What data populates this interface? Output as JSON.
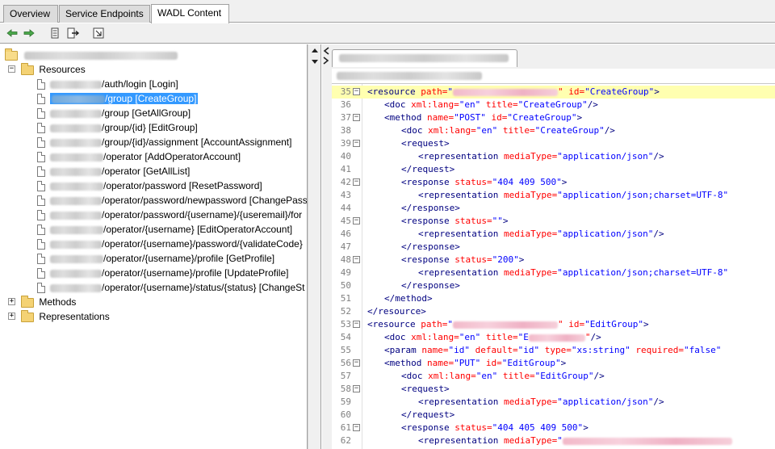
{
  "tabs": [
    {
      "label": "Overview",
      "active": false
    },
    {
      "label": "Service Endpoints",
      "active": false
    },
    {
      "label": "WADL Content",
      "active": true
    }
  ],
  "toolbar": {
    "buttons": [
      {
        "icon": "back-arrow-icon",
        "color": "#3c9a3c"
      },
      {
        "icon": "forward-arrow-icon",
        "color": "#3c9a3c"
      },
      {
        "icon": "document-list-icon"
      },
      {
        "icon": "export-icon"
      },
      {
        "icon": "refresh-window-icon"
      }
    ]
  },
  "tree": {
    "resources_label": "Resources",
    "methods_label": "Methods",
    "representations_label": "Representations",
    "items": [
      {
        "text": "/auth/login [Login]"
      },
      {
        "text": "/group [CreateGroup]",
        "selected": true
      },
      {
        "text": "/group [GetAllGroup]"
      },
      {
        "text": "/group/{id} [EditGroup]"
      },
      {
        "text": "/group/{id}/assignment [AccountAssignment]"
      },
      {
        "text": "/operator [AddOperatorAccount]"
      },
      {
        "text": "/operator [GetAllList]"
      },
      {
        "text": "/operator/password [ResetPassword]"
      },
      {
        "text": "/operator/password/newpassword [ChangePass"
      },
      {
        "text": "/operator/password/{username}/{useremail}/for"
      },
      {
        "text": "/operator/{username} [EditOperatorAccount]"
      },
      {
        "text": "/operator/{username}/password/{validateCode}"
      },
      {
        "text": "/operator/{username}/profile [GetProfile]"
      },
      {
        "text": "/operator/{username}/profile [UpdateProfile]"
      },
      {
        "text": "/operator/{username}/status/{status} [ChangeSt"
      }
    ]
  },
  "colors": {
    "selection": "#3399ff",
    "highlight_line": "#ffffb0",
    "xml_tag": "#000080",
    "xml_attr": "#ff0000",
    "xml_value": "#0000ff"
  },
  "code_lines": [
    {
      "n": "35",
      "fold": true,
      "hl": true,
      "indent": 2,
      "tag": "<resource",
      "parts": [
        [
          "path=",
          "\""
        ],
        [
          "",
          "blur"
        ],
        [
          "\"",
          ""
        ],
        [
          " id=",
          "\"CreateGroup\""
        ]
      ],
      "close": ">"
    },
    {
      "n": "36",
      "indent": 3,
      "tag": "<doc",
      "parts": [
        [
          " xml:lang=",
          "\"en\""
        ],
        [
          " title=",
          "\"CreateGroup\""
        ]
      ],
      "close": "/>"
    },
    {
      "n": "37",
      "fold": true,
      "indent": 3,
      "tag": "<method",
      "parts": [
        [
          " name=",
          "\"POST\""
        ],
        [
          " id=",
          "\"CreateGroup\""
        ]
      ],
      "close": ">"
    },
    {
      "n": "38",
      "indent": 4,
      "tag": "<doc",
      "parts": [
        [
          " xml:lang=",
          "\"en\""
        ],
        [
          " title=",
          "\"CreateGroup\""
        ]
      ],
      "close": "/>"
    },
    {
      "n": "39",
      "fold": true,
      "indent": 4,
      "tag": "<request",
      "parts": [],
      "close": ">"
    },
    {
      "n": "40",
      "indent": 5,
      "tag": "<representation",
      "parts": [
        [
          " mediaType=",
          "\"application/json\""
        ]
      ],
      "close": "/>"
    },
    {
      "n": "41",
      "indent": 4,
      "tag": "</request",
      "parts": [],
      "close": ">"
    },
    {
      "n": "42",
      "fold": true,
      "indent": 4,
      "tag": "<response",
      "parts": [
        [
          " status=",
          "\"404 409 500\""
        ]
      ],
      "close": ">"
    },
    {
      "n": "43",
      "indent": 5,
      "tag": "<representation",
      "parts": [
        [
          " mediaType=",
          "\"application/json;charset=UTF-8\""
        ]
      ],
      "close": ""
    },
    {
      "n": "44",
      "indent": 4,
      "tag": "</response",
      "parts": [],
      "close": ">"
    },
    {
      "n": "45",
      "fold": true,
      "indent": 4,
      "tag": "<response",
      "parts": [
        [
          " status=",
          "\"\""
        ]
      ],
      "close": ">"
    },
    {
      "n": "46",
      "indent": 5,
      "tag": "<representation",
      "parts": [
        [
          " mediaType=",
          "\"application/json\""
        ]
      ],
      "close": "/>"
    },
    {
      "n": "47",
      "indent": 4,
      "tag": "</response",
      "parts": [],
      "close": ">"
    },
    {
      "n": "48",
      "fold": true,
      "indent": 4,
      "tag": "<response",
      "parts": [
        [
          " status=",
          "\"200\""
        ]
      ],
      "close": ">"
    },
    {
      "n": "49",
      "indent": 5,
      "tag": "<representation",
      "parts": [
        [
          " mediaType=",
          "\"application/json;charset=UTF-8\""
        ]
      ],
      "close": ""
    },
    {
      "n": "50",
      "indent": 4,
      "tag": "</response",
      "parts": [],
      "close": ">"
    },
    {
      "n": "51",
      "indent": 3,
      "tag": "</method",
      "parts": [],
      "close": ">"
    },
    {
      "n": "52",
      "indent": 2,
      "tag": "</resource",
      "parts": [],
      "close": ">"
    },
    {
      "n": "53",
      "fold": true,
      "indent": 2,
      "tag": "<resource",
      "parts": [
        [
          "path=",
          "\""
        ],
        [
          "",
          "blur"
        ],
        [
          "\"",
          ""
        ],
        [
          " id=",
          "\"EditGroup\""
        ]
      ],
      "close": ">"
    },
    {
      "n": "54",
      "indent": 3,
      "tag": "<doc",
      "parts": [
        [
          " xml:lang=",
          "\"en\""
        ],
        [
          " title=",
          "\"E"
        ],
        [
          "",
          "blur"
        ],
        [
          "\"",
          ""
        ]
      ],
      "close": "/>"
    },
    {
      "n": "55",
      "indent": 3,
      "tag": "<param",
      "parts": [
        [
          " name=",
          "\"id\""
        ],
        [
          " default=",
          "\"id\""
        ],
        [
          " type=",
          "\"xs:string\""
        ],
        [
          " required=",
          "\"false\""
        ]
      ],
      "close": ""
    },
    {
      "n": "56",
      "fold": true,
      "indent": 3,
      "tag": "<method",
      "parts": [
        [
          " name=",
          "\"PUT\""
        ],
        [
          " id=",
          "\"EditGroup\""
        ]
      ],
      "close": ">"
    },
    {
      "n": "57",
      "indent": 4,
      "tag": "<doc",
      "parts": [
        [
          " xml:lang=",
          "\"en\""
        ],
        [
          " title=",
          "\"EditGroup\""
        ]
      ],
      "close": "/>"
    },
    {
      "n": "58",
      "fold": true,
      "indent": 4,
      "tag": "<request",
      "parts": [],
      "close": ">"
    },
    {
      "n": "59",
      "indent": 5,
      "tag": "<representation",
      "parts": [
        [
          " mediaType=",
          "\"application/json\""
        ]
      ],
      "close": "/>"
    },
    {
      "n": "60",
      "indent": 4,
      "tag": "</request",
      "parts": [],
      "close": ">"
    },
    {
      "n": "61",
      "fold": true,
      "indent": 4,
      "tag": "<response",
      "parts": [
        [
          " status=",
          "\"404 405 409 500\""
        ]
      ],
      "close": ">"
    },
    {
      "n": "62",
      "indent": 5,
      "tag": "<representation",
      "parts": [
        [
          " mediaType=",
          "\""
        ],
        [
          "",
          "blur"
        ]
      ],
      "close": ""
    }
  ]
}
